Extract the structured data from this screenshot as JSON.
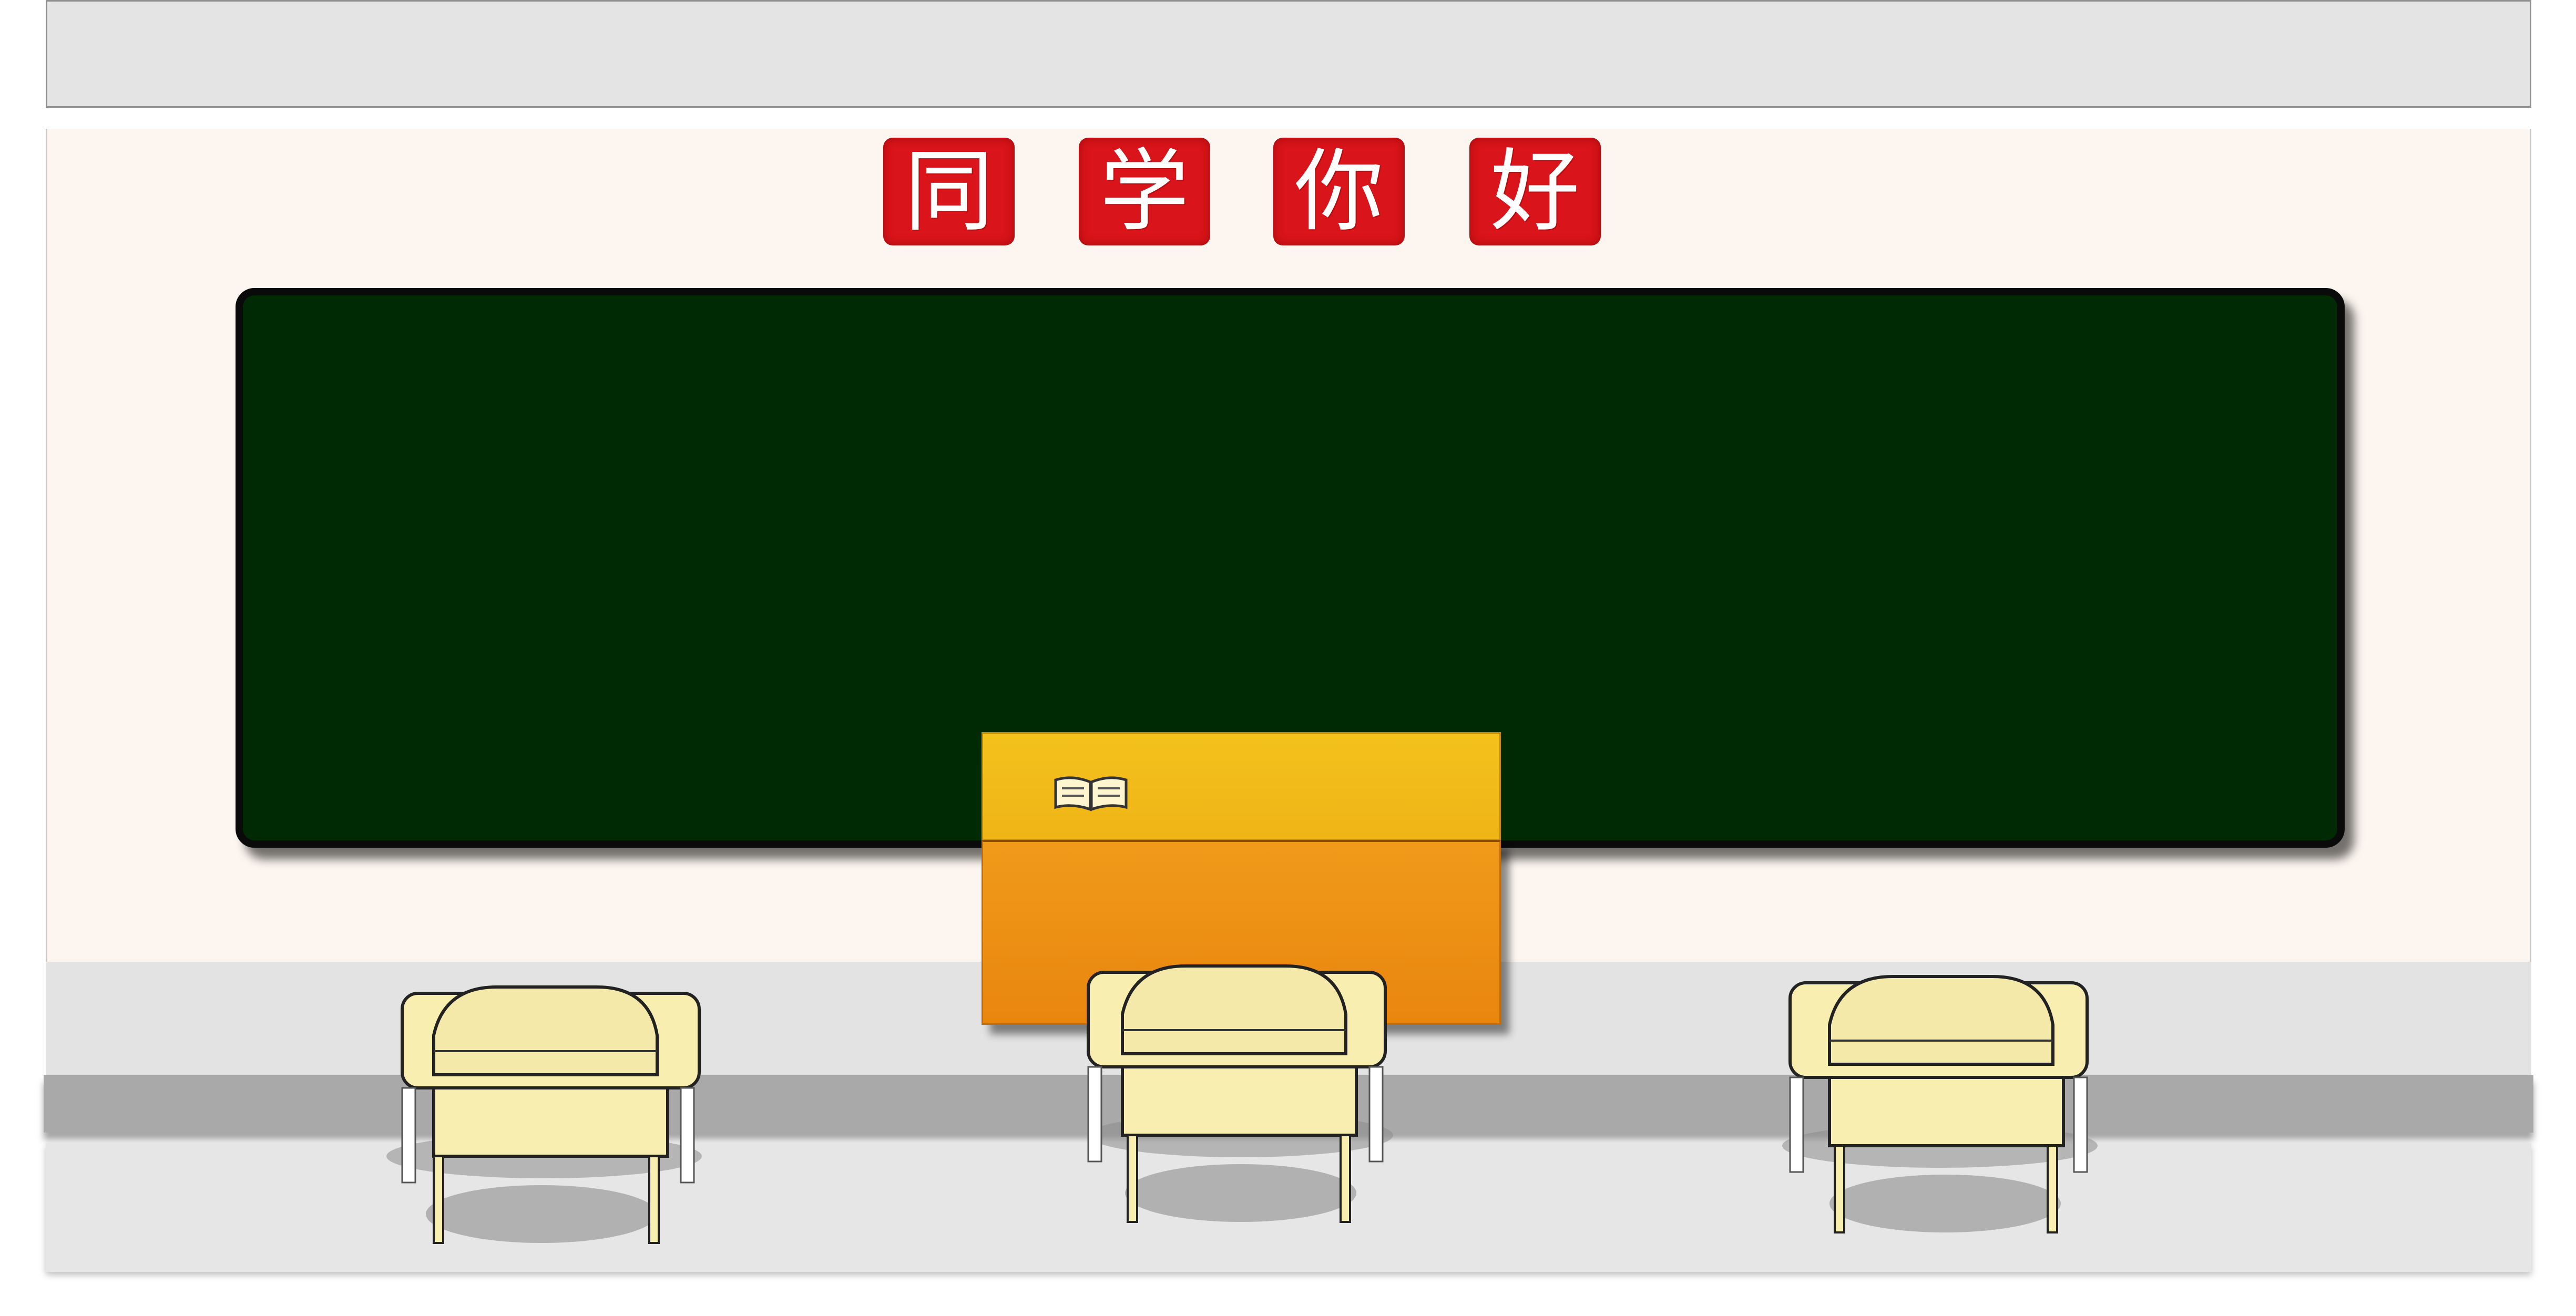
{
  "banner": {
    "characters": [
      "同",
      "学",
      "你",
      "好"
    ],
    "color": "#d9141a"
  },
  "colors": {
    "chalkboard": "#002a04",
    "lectern_top": "#f3c21c",
    "lectern_body": "#ec8f14",
    "desk": "#f8eeb0",
    "wall": "#fdf6f0",
    "floor": "#a9a9a9"
  },
  "icons": {
    "lectern_item": "open-book-icon"
  }
}
